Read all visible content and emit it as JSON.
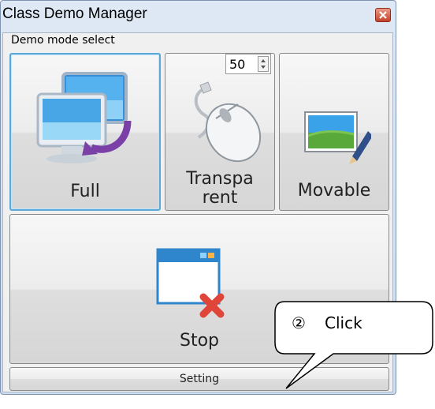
{
  "window": {
    "title": "Class Demo Manager",
    "close_icon": "close-icon"
  },
  "group": {
    "label": "Demo mode select"
  },
  "modes": {
    "full": {
      "label": "Full",
      "icon": "monitor-switch-icon",
      "selected": true
    },
    "transparent": {
      "label_line1": "Transpa",
      "label_line2": "rent",
      "icon": "mouse-icon"
    },
    "movable": {
      "label": "Movable",
      "icon": "image-edit-icon"
    }
  },
  "transparency_spinner": {
    "value": "50"
  },
  "stop_button": {
    "label": "Stop",
    "icon": "window-close-icon"
  },
  "setting_button": {
    "label": "Setting"
  },
  "callout": {
    "marker": "②",
    "text": "Click"
  },
  "colors": {
    "accent_selected": "#5aa9d8",
    "close_red": "#c5412a",
    "stop_x_red": "#e0453a"
  }
}
